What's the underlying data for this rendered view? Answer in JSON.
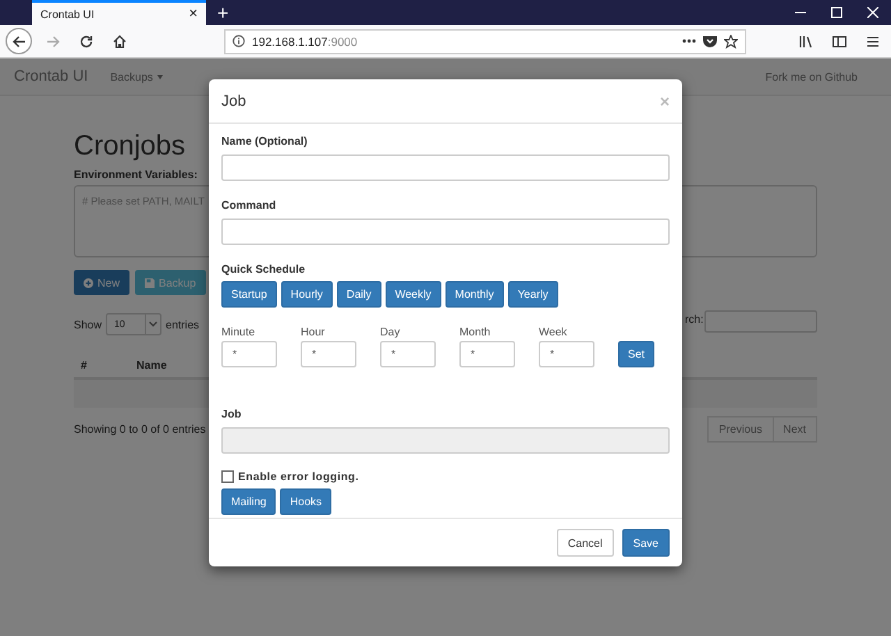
{
  "browser": {
    "tab_title": "Crontab UI",
    "tab_close": "×",
    "new_tab": "+",
    "url_host": "192.168.1.107",
    "url_port": ":9000"
  },
  "navbar": {
    "brand": "Crontab UI",
    "menu": "Backups",
    "link": "Fork me on Github"
  },
  "page": {
    "heading": "Cronjobs",
    "env_label": "Environment Variables:",
    "env_placeholder": "# Please set PATH, MAILT",
    "buttons": [
      {
        "label": "New",
        "kind": "new"
      },
      {
        "label": "Backup",
        "kind": "backup"
      }
    ],
    "show_label": "Show",
    "page_size": "10",
    "entries_label": "entries",
    "search_label": "rch:",
    "columns": [
      "#",
      "Name"
    ],
    "info": "Showing 0 to 0 of 0 entries",
    "pagination": [
      "Previous",
      "Next"
    ]
  },
  "modal": {
    "title": "Job",
    "close": "×",
    "fields": [
      {
        "label": "Name (Optional)"
      },
      {
        "label": "Command"
      }
    ],
    "quick_schedule_label": "Quick Schedule",
    "quick_buttons": [
      "Startup",
      "Hourly",
      "Daily",
      "Weekly",
      "Monthly",
      "Yearly"
    ],
    "schedule": [
      {
        "label": "Minute",
        "value": "*"
      },
      {
        "label": "Hour",
        "value": "*"
      },
      {
        "label": "Day",
        "value": "*"
      },
      {
        "label": "Month",
        "value": "*"
      },
      {
        "label": "Week",
        "value": "*"
      }
    ],
    "set_button": "Set",
    "job_label": "Job",
    "error_logging": {
      "label": "Enable error logging.",
      "checked": false
    },
    "extra_buttons": [
      "Mailing",
      "Hooks"
    ],
    "footer_buttons": [
      {
        "label": "Cancel",
        "kind": "default"
      },
      {
        "label": "Save",
        "kind": "primary"
      }
    ]
  }
}
